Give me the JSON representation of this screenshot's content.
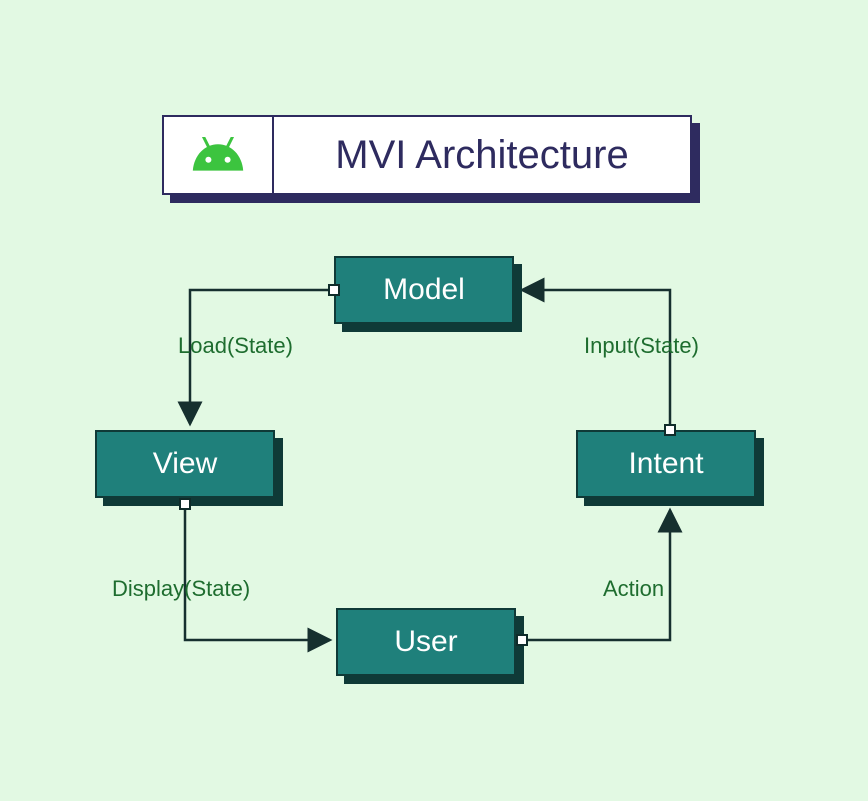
{
  "title": "MVI Architecture",
  "nodes": {
    "model": "Model",
    "view": "View",
    "intent": "Intent",
    "user": "User"
  },
  "edges": {
    "load": "Load(State)",
    "input": "Input(State)",
    "display": "Display(State)",
    "action": "Action"
  },
  "colors": {
    "bg": "#e2f9e3",
    "nodeFill": "#1f807b",
    "nodeShadow": "#0f3a37",
    "titleText": "#2e2b5f",
    "edgeLabel": "#1e6d2f",
    "android": "#3cc43f"
  }
}
